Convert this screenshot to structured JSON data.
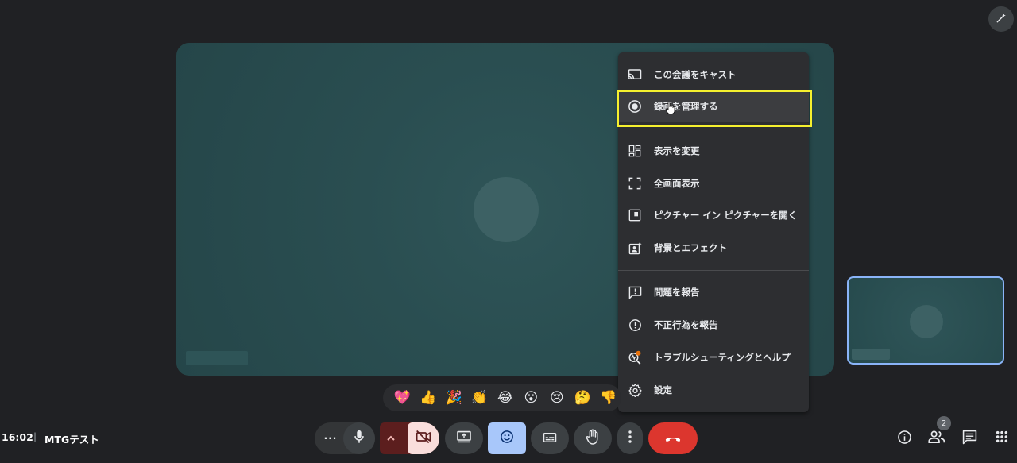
{
  "meeting": {
    "time": "16:02",
    "separator": "|",
    "title": "MTGテスト"
  },
  "menu": {
    "items": [
      {
        "label": "この会議をキャスト",
        "icon": "cast-icon"
      },
      {
        "label": "録画を管理する",
        "icon": "record-icon"
      },
      {
        "label": "表示を変更",
        "icon": "layout-icon"
      },
      {
        "label": "全画面表示",
        "icon": "fullscreen-icon"
      },
      {
        "label": "ピクチャー イン ピクチャーを開く",
        "icon": "picture-in-picture-icon"
      },
      {
        "label": "背景とエフェクト",
        "icon": "effects-icon"
      },
      {
        "label": "問題を報告",
        "icon": "report-problem-icon"
      },
      {
        "label": "不正行為を報告",
        "icon": "report-abuse-icon"
      },
      {
        "label": "トラブルシューティングとヘルプ",
        "icon": "troubleshoot-icon"
      },
      {
        "label": "設定",
        "icon": "settings-icon"
      }
    ],
    "highlighted_item": "録画を管理する"
  },
  "reactions": [
    "💖",
    "👍",
    "🎉",
    "👏",
    "😂",
    "😮",
    "😢",
    "🤔",
    "👎"
  ],
  "controls": {
    "more_reactions": "···",
    "participants_badge": "2"
  },
  "colors": {
    "background": "#202124",
    "tile": "#2a4e51",
    "end_call": "#dc362e",
    "highlight": "#f5f02e",
    "active_reaction_button": "#a8c7fa"
  }
}
